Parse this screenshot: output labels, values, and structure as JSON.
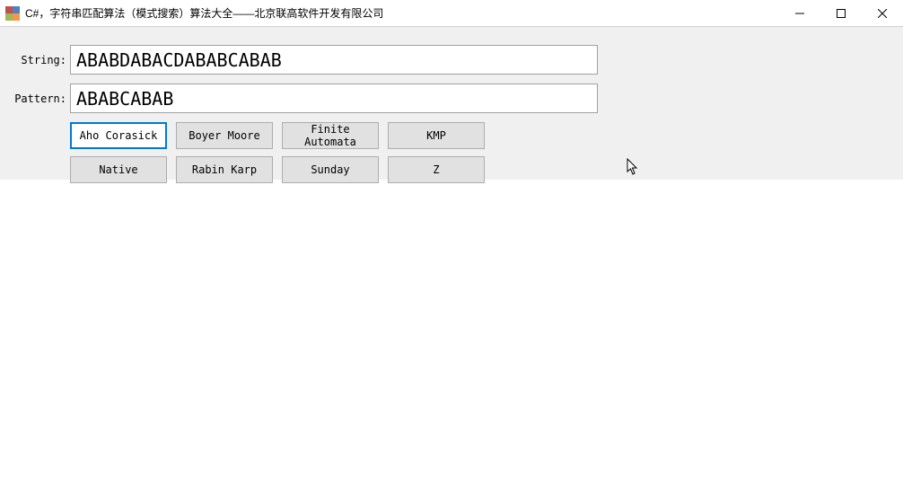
{
  "window": {
    "title": "C#，字符串匹配算法（模式搜索）算法大全——北京联高软件开发有限公司"
  },
  "form": {
    "stringLabel": "String:",
    "stringValue": "ABABDABACDABABCABAB",
    "patternLabel": "Pattern:",
    "patternValue": "ABABCABAB"
  },
  "buttons": {
    "row1": [
      {
        "label": "Aho Corasick",
        "selected": true
      },
      {
        "label": "Boyer Moore",
        "selected": false
      },
      {
        "label": "Finite Automata",
        "selected": false
      },
      {
        "label": "KMP",
        "selected": false
      }
    ],
    "row2": [
      {
        "label": "Native",
        "selected": false
      },
      {
        "label": "Rabin Karp",
        "selected": false
      },
      {
        "label": "Sunday",
        "selected": false
      },
      {
        "label": "Z",
        "selected": false
      }
    ]
  }
}
